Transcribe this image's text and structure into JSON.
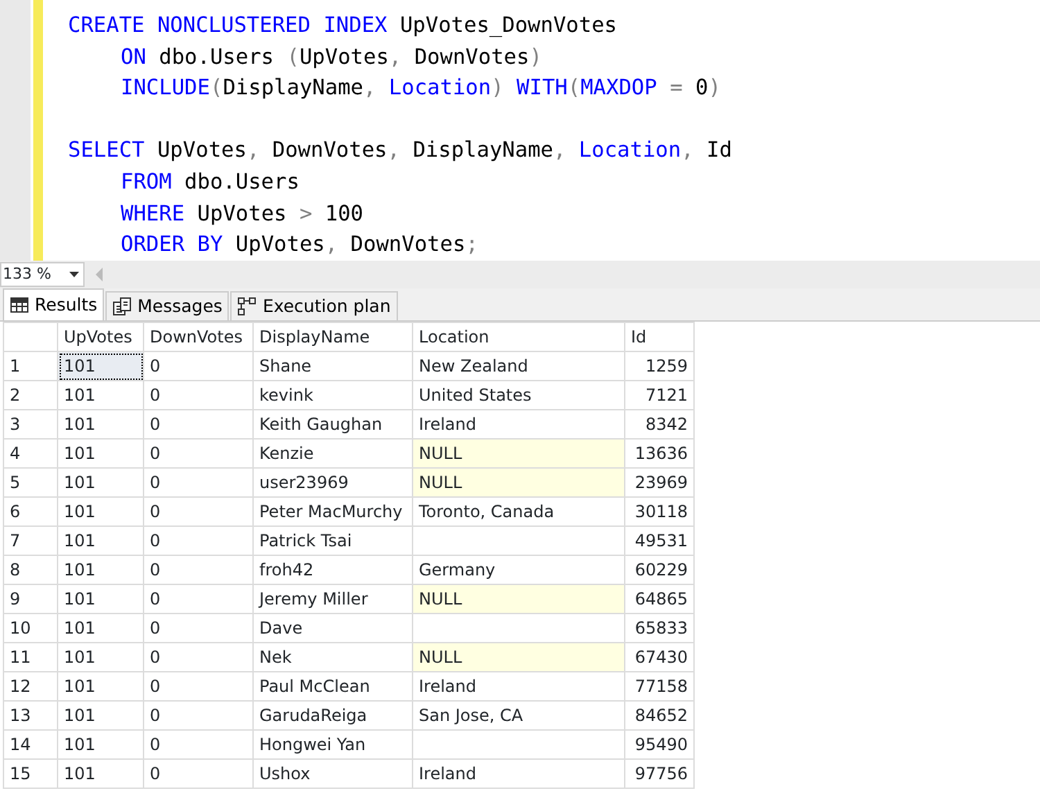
{
  "editor": {
    "lines": [
      {
        "indent": false,
        "tokens": [
          {
            "kind": "keyword",
            "text": "CREATE NONCLUSTERED INDEX"
          },
          {
            "kind": "text",
            "text": " UpVotes_DownVotes"
          }
        ]
      },
      {
        "indent": true,
        "tokens": [
          {
            "kind": "keyword",
            "text": "ON"
          },
          {
            "kind": "text",
            "text": " dbo.Users "
          },
          {
            "kind": "gray",
            "text": "("
          },
          {
            "kind": "text",
            "text": "UpVotes"
          },
          {
            "kind": "gray",
            "text": ", "
          },
          {
            "kind": "text",
            "text": "DownVotes"
          },
          {
            "kind": "gray",
            "text": ")"
          }
        ]
      },
      {
        "indent": true,
        "tokens": [
          {
            "kind": "keyword",
            "text": "INCLUDE"
          },
          {
            "kind": "gray",
            "text": "("
          },
          {
            "kind": "text",
            "text": "DisplayName"
          },
          {
            "kind": "gray",
            "text": ", "
          },
          {
            "kind": "keyword",
            "text": "Location"
          },
          {
            "kind": "gray",
            "text": ") "
          },
          {
            "kind": "keyword",
            "text": "WITH"
          },
          {
            "kind": "gray",
            "text": "("
          },
          {
            "kind": "keyword",
            "text": "MAXDOP"
          },
          {
            "kind": "gray",
            "text": " = "
          },
          {
            "kind": "text",
            "text": "0"
          },
          {
            "kind": "gray",
            "text": ")"
          }
        ]
      },
      {
        "indent": false
      },
      {
        "indent": false,
        "tokens": [
          {
            "kind": "keyword",
            "text": "SELECT"
          },
          {
            "kind": "text",
            "text": " UpVotes"
          },
          {
            "kind": "gray",
            "text": ", "
          },
          {
            "kind": "text",
            "text": "DownVotes"
          },
          {
            "kind": "gray",
            "text": ", "
          },
          {
            "kind": "text",
            "text": "DisplayName"
          },
          {
            "kind": "gray",
            "text": ", "
          },
          {
            "kind": "keyword",
            "text": "Location"
          },
          {
            "kind": "gray",
            "text": ", "
          },
          {
            "kind": "text",
            "text": "Id"
          }
        ]
      },
      {
        "indent": true,
        "tokens": [
          {
            "kind": "keyword",
            "text": "FROM"
          },
          {
            "kind": "text",
            "text": " dbo.Users"
          }
        ]
      },
      {
        "indent": true,
        "tokens": [
          {
            "kind": "keyword",
            "text": "WHERE"
          },
          {
            "kind": "text",
            "text": " UpVotes "
          },
          {
            "kind": "gray",
            "text": ">"
          },
          {
            "kind": "text",
            "text": " 100"
          }
        ]
      },
      {
        "indent": true,
        "tokens": [
          {
            "kind": "keyword",
            "text": "ORDER BY"
          },
          {
            "kind": "text",
            "text": " UpVotes"
          },
          {
            "kind": "gray",
            "text": ", "
          },
          {
            "kind": "text",
            "text": "DownVotes"
          },
          {
            "kind": "gray",
            "text": ";"
          }
        ]
      }
    ]
  },
  "zoom": {
    "value": "133 %"
  },
  "tabs": [
    {
      "label": "Results",
      "kind": "grid",
      "selected": true
    },
    {
      "label": "Messages",
      "kind": "messages",
      "selected": false
    },
    {
      "label": "Execution plan",
      "kind": "plan",
      "selected": false
    }
  ],
  "table": {
    "columns": [
      "UpVotes",
      "DownVotes",
      "DisplayName",
      "Location",
      "Id"
    ],
    "rows": [
      {
        "number": "1",
        "focused": true,
        "location_null": false,
        "cells": [
          "101",
          "0",
          "Shane",
          "New Zealand",
          "1259"
        ]
      },
      {
        "number": "2",
        "focused": false,
        "location_null": false,
        "cells": [
          "101",
          "0",
          "kevink",
          "United States",
          "7121"
        ]
      },
      {
        "number": "3",
        "focused": false,
        "location_null": false,
        "cells": [
          "101",
          "0",
          "Keith Gaughan",
          "Ireland",
          "8342"
        ]
      },
      {
        "number": "4",
        "focused": false,
        "location_null": true,
        "cells": [
          "101",
          "0",
          "Kenzie",
          "NULL",
          "13636"
        ]
      },
      {
        "number": "5",
        "focused": false,
        "location_null": true,
        "cells": [
          "101",
          "0",
          "user23969",
          "NULL",
          "23969"
        ]
      },
      {
        "number": "6",
        "focused": false,
        "location_null": false,
        "cells": [
          "101",
          "0",
          "Peter MacMurchy",
          "Toronto, Canada",
          "30118"
        ]
      },
      {
        "number": "7",
        "focused": false,
        "location_null": false,
        "cells": [
          "101",
          "0",
          "Patrick Tsai",
          null,
          "49531"
        ]
      },
      {
        "number": "8",
        "focused": false,
        "location_null": false,
        "cells": [
          "101",
          "0",
          "froh42",
          "Germany",
          "60229"
        ]
      },
      {
        "number": "9",
        "focused": false,
        "location_null": true,
        "cells": [
          "101",
          "0",
          "Jeremy Miller",
          "NULL",
          "64865"
        ]
      },
      {
        "number": "10",
        "focused": false,
        "location_null": false,
        "cells": [
          "101",
          "0",
          "Dave",
          null,
          "65833"
        ]
      },
      {
        "number": "11",
        "focused": false,
        "location_null": true,
        "cells": [
          "101",
          "0",
          "Nek",
          "NULL",
          "67430"
        ]
      },
      {
        "number": "12",
        "focused": false,
        "location_null": false,
        "cells": [
          "101",
          "0",
          "Paul McClean",
          "Ireland",
          "77158"
        ]
      },
      {
        "number": "13",
        "focused": false,
        "location_null": false,
        "cells": [
          "101",
          "0",
          "GarudaReiga",
          "San Jose, CA",
          "84652"
        ]
      },
      {
        "number": "14",
        "focused": false,
        "location_null": false,
        "cells": [
          "101",
          "0",
          "Hongwei Yan",
          null,
          "95490"
        ]
      },
      {
        "number": "15",
        "focused": false,
        "location_null": false,
        "cells": [
          "101",
          "0",
          "Ushox",
          "Ireland",
          "97756"
        ]
      }
    ]
  }
}
